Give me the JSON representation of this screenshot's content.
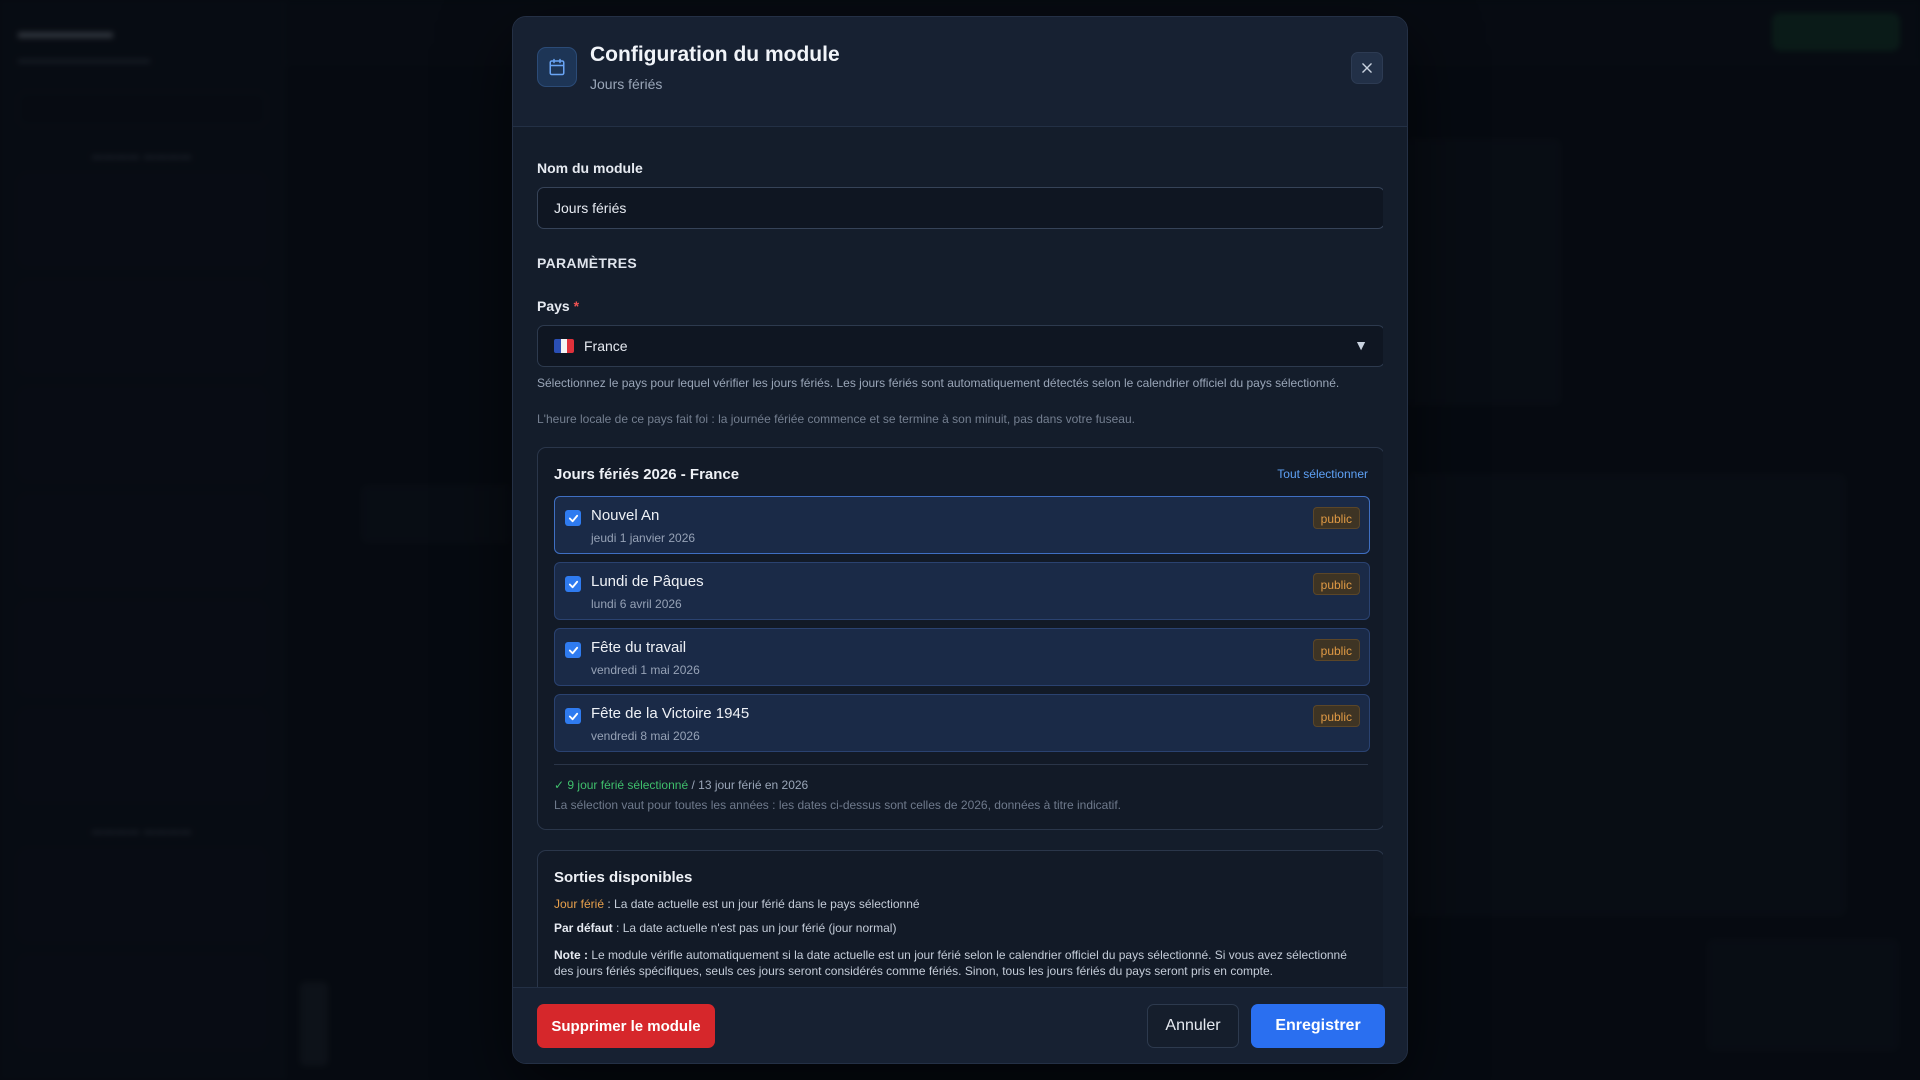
{
  "modal": {
    "title": "Configuration du module",
    "subtitle": "Jours fériés",
    "icon": "calendar-icon"
  },
  "form": {
    "name_label": "Nom du module",
    "name_value": "Jours fériés",
    "params_title": "PARAMÈTRES",
    "country_label": "Pays",
    "required_mark": "*",
    "country_value": "France",
    "country_caret": "▼",
    "help_1": "Sélectionnez le pays pour lequel vérifier les jours fériés. Les jours fériés sont automatiquement détectés selon le calendrier officiel du pays sélectionné.",
    "help_2": "L'heure locale de ce pays fait foi : la journée fériée commence et se termine à son minuit, pas dans votre fuseau."
  },
  "holidays": {
    "title": "Jours fériés 2026 - France",
    "select_all": "Tout sélectionner",
    "items": [
      {
        "name": "Nouvel An",
        "date": "jeudi 1 janvier 2026",
        "type": "public",
        "checked": true
      },
      {
        "name": "Lundi de Pâques",
        "date": "lundi 6 avril 2026",
        "type": "public",
        "checked": true
      },
      {
        "name": "Fête du travail",
        "date": "vendredi 1 mai 2026",
        "type": "public",
        "checked": true
      },
      {
        "name": "Fête de la Victoire 1945",
        "date": "vendredi 8 mai 2026",
        "type": "public",
        "checked": true
      }
    ],
    "summary_selected": "✓ 9 jour férié sélectionné",
    "summary_total": " / 13 jour férié en 2026",
    "note": "La sélection vaut pour toutes les années : les dates ci-dessus sont celles de 2026, données à titre indicatif."
  },
  "outputs": {
    "title": "Sorties disponibles",
    "holiday_label": "Jour férié",
    "holiday_desc": " : La date actuelle est un jour férié dans le pays sélectionné",
    "default_label": "Par défaut",
    "default_desc": " : La date actuelle n'est pas un jour férié (jour normal)",
    "note_label": "Note :",
    "note_text": " Le module vérifie automatiquement si la date actuelle est un jour férié selon le calendrier officiel du pays sélectionné. Si vous avez sélectionné des jours fériés spécifiques, seuls ces jours seront considérés comme fériés. Sinon, tous les jours fériés du pays seront pris en compte."
  },
  "footer": {
    "delete_label": "Supprimer le module",
    "cancel_label": "Annuler",
    "save_label": "Enregistrer"
  },
  "colors": {
    "accent": "#2a6ff0",
    "danger": "#d6272b",
    "badge": "#e09a45",
    "success": "#3fbf6c"
  }
}
